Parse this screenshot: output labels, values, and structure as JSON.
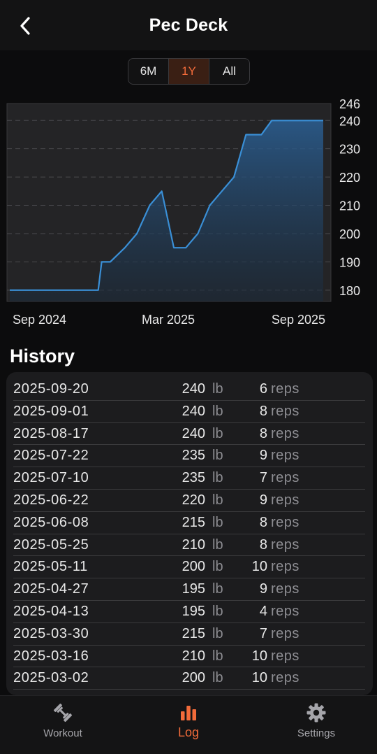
{
  "header": {
    "title": "Pec Deck"
  },
  "range_selector": {
    "options": [
      "6M",
      "1Y",
      "All"
    ],
    "selected": "1Y"
  },
  "colors": {
    "accent": "#f26b3a",
    "line": "#3a8fd6",
    "background": "#0c0c0d"
  },
  "chart_data": {
    "type": "area",
    "title": "",
    "xlabel": "",
    "ylabel": "",
    "x_tick_labels": [
      "Sep 2024",
      "Mar 2025",
      "Sep 2025"
    ],
    "y_ticks": [
      246,
      240,
      230,
      220,
      210,
      200,
      190,
      180
    ],
    "ylim": [
      176,
      246
    ],
    "grid": true,
    "y_axis_side": "right",
    "series": [
      {
        "points": [
          [
            "2024-09-20",
            180
          ],
          [
            "2024-10-30",
            180
          ],
          [
            "2024-12-10",
            180
          ],
          [
            "2025-01-01",
            180
          ],
          [
            "2025-01-05",
            190
          ],
          [
            "2025-01-15",
            190
          ],
          [
            "2025-02-01",
            195
          ],
          [
            "2025-02-15",
            200
          ],
          [
            "2025-03-02",
            210
          ],
          [
            "2025-03-16",
            215
          ],
          [
            "2025-03-30",
            195
          ],
          [
            "2025-04-13",
            195
          ],
          [
            "2025-04-27",
            200
          ],
          [
            "2025-05-11",
            210
          ],
          [
            "2025-05-25",
            215
          ],
          [
            "2025-06-08",
            220
          ],
          [
            "2025-06-22",
            235
          ],
          [
            "2025-07-10",
            235
          ],
          [
            "2025-07-22",
            240
          ],
          [
            "2025-09-20",
            240
          ]
        ]
      }
    ]
  },
  "history": {
    "title": "History",
    "weight_unit": "lb",
    "reps_unit": "reps",
    "rows": [
      {
        "date": "2025-09-20",
        "weight": "240",
        "reps": "6"
      },
      {
        "date": "2025-09-01",
        "weight": "240",
        "reps": "8"
      },
      {
        "date": "2025-08-17",
        "weight": "240",
        "reps": "8"
      },
      {
        "date": "2025-07-22",
        "weight": "235",
        "reps": "9"
      },
      {
        "date": "2025-07-10",
        "weight": "235",
        "reps": "7"
      },
      {
        "date": "2025-06-22",
        "weight": "220",
        "reps": "9"
      },
      {
        "date": "2025-06-08",
        "weight": "215",
        "reps": "8"
      },
      {
        "date": "2025-05-25",
        "weight": "210",
        "reps": "8"
      },
      {
        "date": "2025-05-11",
        "weight": "200",
        "reps": "10"
      },
      {
        "date": "2025-04-27",
        "weight": "195",
        "reps": "9"
      },
      {
        "date": "2025-04-13",
        "weight": "195",
        "reps": "4"
      },
      {
        "date": "2025-03-30",
        "weight": "215",
        "reps": "7"
      },
      {
        "date": "2025-03-16",
        "weight": "210",
        "reps": "10"
      },
      {
        "date": "2025-03-02",
        "weight": "200",
        "reps": "10"
      }
    ]
  },
  "tabbar": {
    "items": [
      {
        "label": "Workout",
        "icon": "dumbbell-icon"
      },
      {
        "label": "Log",
        "icon": "bar-chart-icon"
      },
      {
        "label": "Settings",
        "icon": "gear-icon"
      }
    ],
    "active": "Log"
  }
}
